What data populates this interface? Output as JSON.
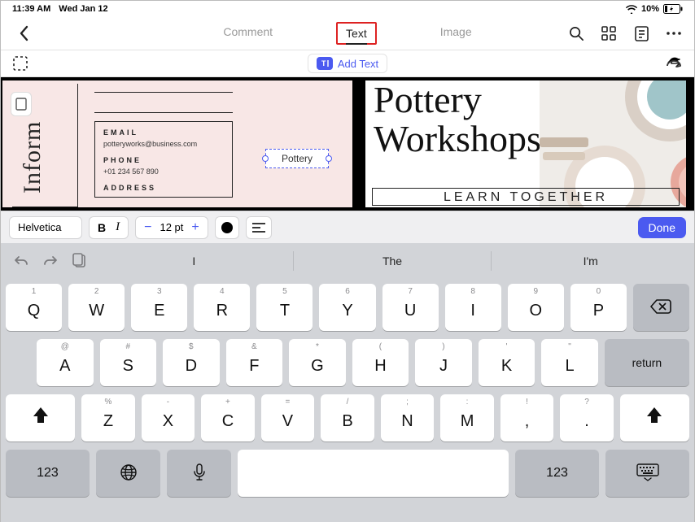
{
  "status": {
    "time": "11:39 AM",
    "date": "Wed Jan 12",
    "battery": "10%"
  },
  "nav": {
    "tabs": {
      "comment": "Comment",
      "text": "Text",
      "image": "Image"
    },
    "add_text": "Add Text"
  },
  "doc": {
    "inform": "Inform",
    "contact": {
      "email_label": "EMAIL",
      "email": "potteryworks@business.com",
      "phone_label": "PHONE",
      "phone": "+01 234 567 890",
      "address_label": "ADDRESS"
    },
    "editing_text": "Pottery",
    "title_line1": "Pottery",
    "title_line2": "Workshops",
    "banner": "LEARN TOGETHER"
  },
  "format": {
    "font": "Helvetica",
    "bold": "B",
    "italic": "I",
    "size": "12 pt",
    "done": "Done"
  },
  "kb": {
    "suggestions": [
      "I",
      "The",
      "I'm"
    ],
    "row1_alt": [
      "1",
      "2",
      "3",
      "4",
      "5",
      "6",
      "7",
      "8",
      "9",
      "0"
    ],
    "row1": [
      "Q",
      "W",
      "E",
      "R",
      "T",
      "Y",
      "U",
      "I",
      "O",
      "P"
    ],
    "row2_alt": [
      "@",
      "#",
      "$",
      "&",
      "*",
      "(",
      ")",
      "'",
      "\""
    ],
    "row2": [
      "A",
      "S",
      "D",
      "F",
      "G",
      "H",
      "J",
      "K",
      "L"
    ],
    "row3_alt": [
      "%",
      "-",
      "+",
      "=",
      "/",
      ";",
      ":",
      "!",
      "?"
    ],
    "row3": [
      "Z",
      "X",
      "C",
      "V",
      "B",
      "N",
      "M",
      ",",
      "."
    ],
    "return": "return",
    "num": "123"
  }
}
